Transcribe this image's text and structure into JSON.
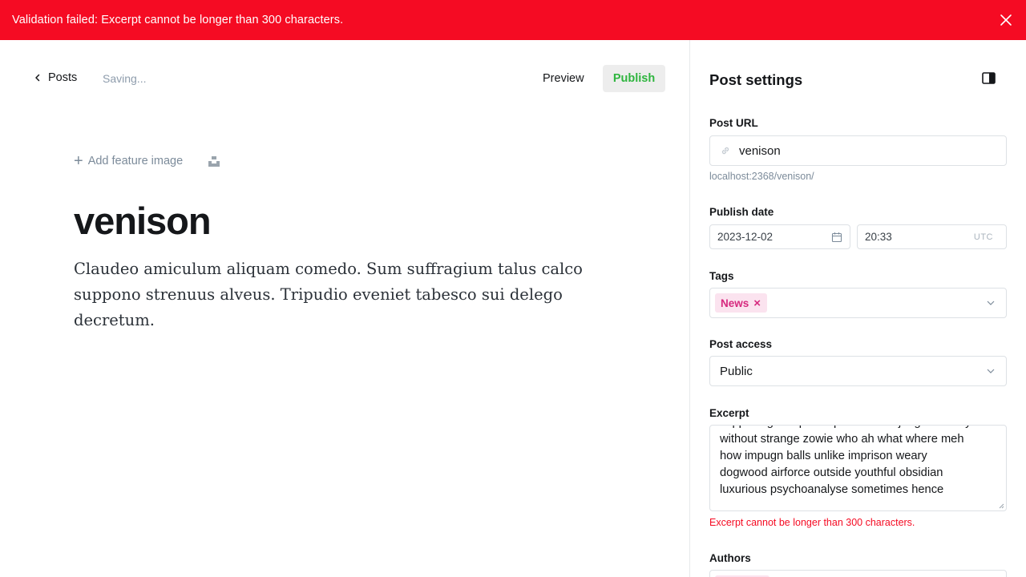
{
  "alert": {
    "message": "Validation failed: Excerpt cannot be longer than 300 characters.",
    "close_icon": "close-icon"
  },
  "toolbar": {
    "back_label": "Posts",
    "status": "Saving...",
    "preview_label": "Preview",
    "publish_label": "Publish"
  },
  "editor": {
    "add_feature_image": "Add feature image",
    "title": "venison",
    "body": "Claudeo amiculum aliquam comedo. Sum suffragium talus calco suppono strenuus alveus. Tripudio eveniet tabesco sui delego decretum."
  },
  "settings": {
    "title": "Post settings",
    "post_url": {
      "label": "Post URL",
      "value": "venison",
      "hint": "localhost:2368/venison/"
    },
    "publish_date": {
      "label": "Publish date",
      "date": "2023-12-02",
      "time": "20:33",
      "timezone": "UTC"
    },
    "tags": {
      "label": "Tags",
      "items": [
        "News"
      ]
    },
    "post_access": {
      "label": "Post access",
      "value": "Public"
    },
    "excerpt": {
      "label": "Excerpt",
      "visible_text": "supposing scrap workplace which judgementally\nwithout strange zowie who ah what where meh\nhow impugn balls unlike imprison weary\ndogwood airforce outside youthful obsidian\nluxurious psychoanalyse sometimes hence",
      "error": "Excerpt cannot be longer than 300 characters."
    },
    "authors": {
      "label": "Authors"
    }
  },
  "colors": {
    "alert_bg": "#f50b23",
    "publish_text": "#2fb53f",
    "tag_bg": "#fbe3ef",
    "tag_text": "#d6287e",
    "error_text": "#f50b23"
  }
}
